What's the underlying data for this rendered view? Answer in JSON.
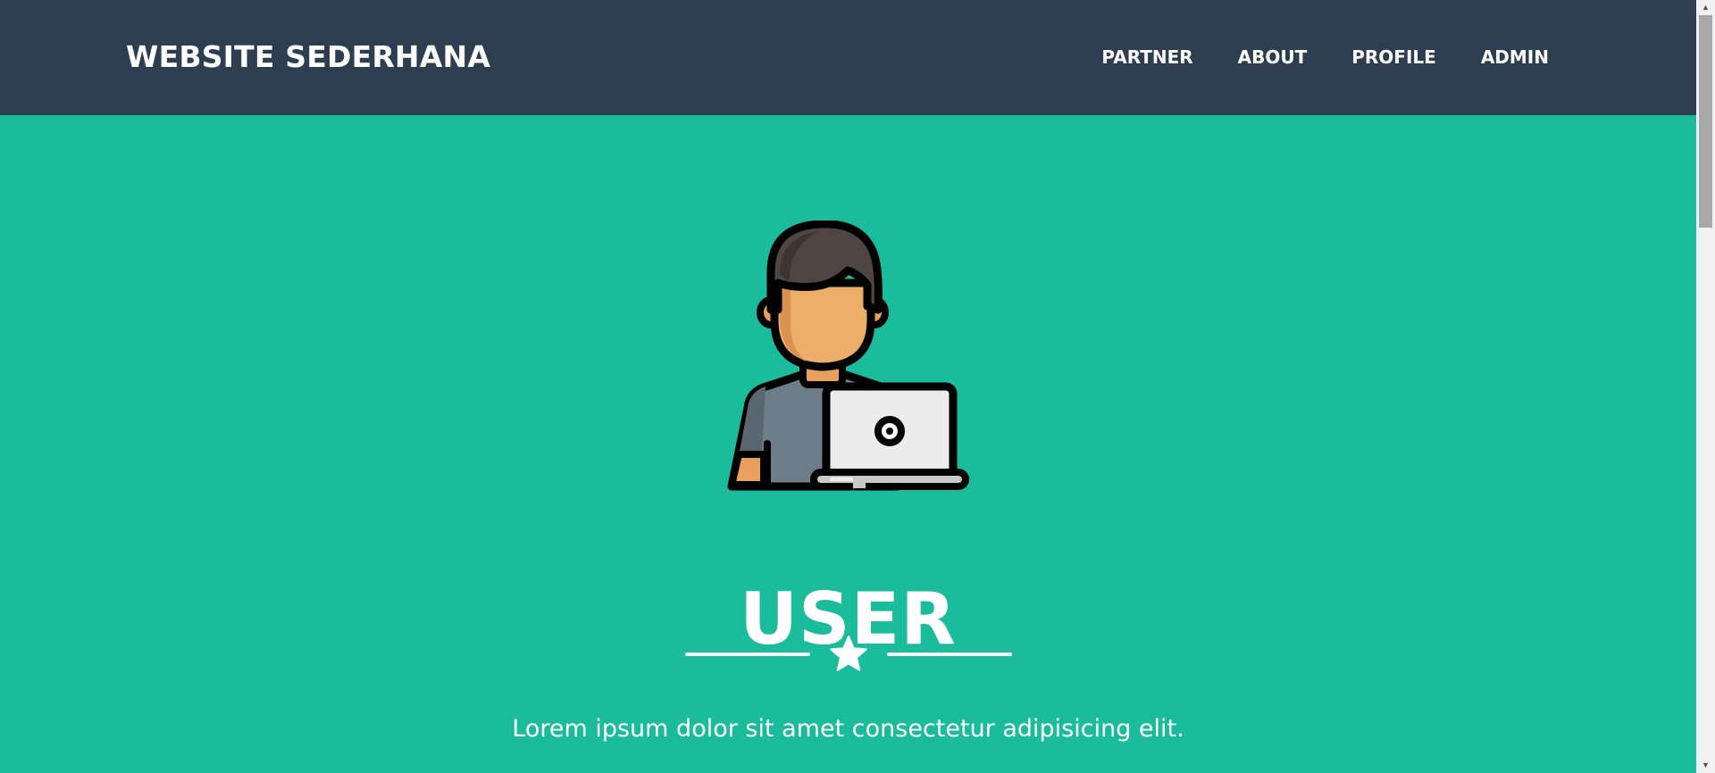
{
  "navbar": {
    "brand": "WEBSITE SEDERHANA",
    "items": [
      {
        "label": "PARTNER"
      },
      {
        "label": "ABOUT"
      },
      {
        "label": "PROFILE"
      },
      {
        "label": "ADMIN"
      }
    ]
  },
  "masthead": {
    "avatar_icon": "user-laptop-icon",
    "title": "USER",
    "divider_icon": "star-icon",
    "subtitle": "Lorem ipsum dolor sit amet consectetur adipisicing elit."
  },
  "colors": {
    "navbar": "#2c3e50",
    "masthead": "#1abc9c",
    "text": "#ffffff"
  }
}
